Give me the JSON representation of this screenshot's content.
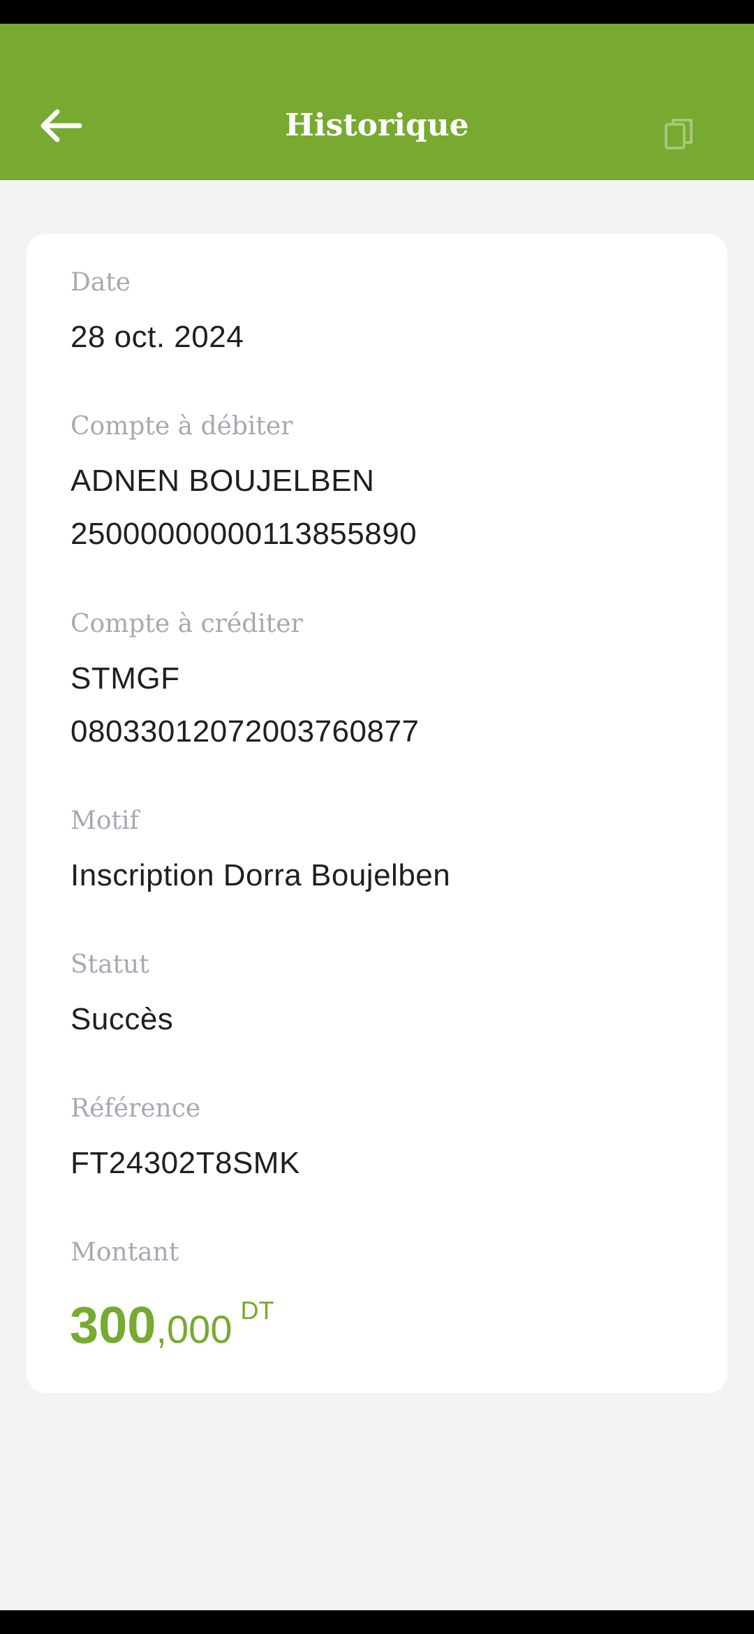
{
  "header": {
    "title": "Historique",
    "back_icon": "arrow-left-icon",
    "copy_icon": "copy-icon",
    "bar_color": "#78a931"
  },
  "details": {
    "date_label": "Date",
    "date_value": "28 oct. 2024",
    "debit_label": "Compte à débiter",
    "debit_name": "ADNEN  BOUJELBEN",
    "debit_account": "25000000000113855890",
    "credit_label": "Compte à créditer",
    "credit_name": "STMGF",
    "credit_account": "08033012072003760877",
    "motif_label": "Motif",
    "motif_value": "Inscription Dorra Boujelben",
    "status_label": "Statut",
    "status_value": "Succès",
    "reference_label": "Référence",
    "reference_value": "FT24302T8SMK",
    "amount_label": "Montant",
    "amount_integer": "300",
    "amount_decimal": ",000",
    "amount_currency": "DT",
    "amount_color": "#78a931"
  }
}
